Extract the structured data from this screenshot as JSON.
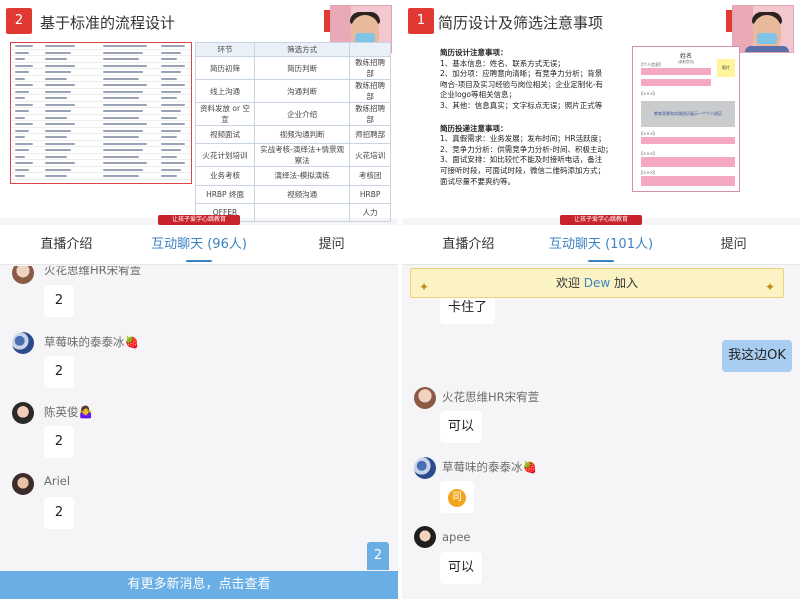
{
  "left": {
    "slide": {
      "number": "2",
      "title": "基于标准的流程设计",
      "table_headers": [
        "环节",
        "筛选方式"
      ],
      "rows": [
        [
          "简历初筛",
          "简历判断",
          "教练招聘部"
        ],
        [
          "线上沟通",
          "沟通判断",
          "教练招聘部"
        ],
        [
          "资料发放 or 空宣",
          "企业介绍",
          "教练招聘部"
        ],
        [
          "视频面试",
          "视频沟通判断",
          "师招聘部"
        ],
        [
          "火花计划培训",
          "实战考核-演绎法+情景观察法",
          "火花培训"
        ],
        [
          "业务考核",
          "演绎法-模拟演练",
          "考核团"
        ],
        [
          "HRBP 终面",
          "视频沟通",
          "HRBP"
        ],
        [
          "OFFER",
          "",
          "人力"
        ]
      ]
    },
    "brand": "让孩子爱学心跳教育",
    "tabs": [
      "直播介绍",
      "互动聊天 (96人)",
      "提问"
    ],
    "messages": [
      {
        "name": "火花思维HR宋宥萱",
        "text": "2"
      },
      {
        "name": "草莓味的泰泰冰🍓",
        "text": "2"
      },
      {
        "name": "陈英俊🤷‍♀️",
        "text": "2"
      },
      {
        "name": "Ariel",
        "text": "2"
      }
    ],
    "new_messages": "有更多新消息，点击查看",
    "unread": "2"
  },
  "right": {
    "slide": {
      "number": "1",
      "title": "简历设计及筛选注意事项",
      "design_heading": "简历设计注意事项：",
      "design_lines": [
        "1、基本信息：姓名、联系方式无误；",
        "2、加分项：应聘意向清晰；有竞争力分析；背景",
        "吻合-项目及实习经验与岗位相关；企业定制化-有",
        "企业logo等相关信息；",
        "3、其他：信息真实；文字标点无误；照片正式等"
      ],
      "delivery_heading": "简历投递注意事项：",
      "delivery_lines": [
        "1、真假需求：业务发展；发布时间；HR活跃度；",
        "2、竞争力分析：供需竞争力分析-时间、积极主动；",
        "3、面试安排：如比较忙不能及时接听电话，备注",
        "可接听时段，可面试时段，微信二维码添加方式；",
        "面试尽量不要爽约等。"
      ],
      "resume": {
        "title": "姓名",
        "subtitle": "(求职意向)",
        "photo": "照片",
        "image_note": "教育背景和实践经历展示一个个人经历",
        "section": "【个人信息】",
        "marker": "【×××】"
      }
    },
    "brand": "让孩子爱学心跳教育",
    "tabs": [
      "直播介绍",
      "互动聊天 (101人)",
      "提问"
    ],
    "welcome_prefix": "欢迎",
    "welcome_user": "Dew",
    "welcome_suffix": "加入",
    "messages": [
      {
        "name": "",
        "text": "卡住了"
      },
      {
        "name": "self",
        "text": "我这边OK"
      },
      {
        "name": "火花思维HR宋宥萱",
        "text": "可以"
      },
      {
        "name": "草莓味的泰泰冰🍓",
        "text": "司"
      },
      {
        "name": "apee",
        "text": "可以"
      }
    ]
  }
}
